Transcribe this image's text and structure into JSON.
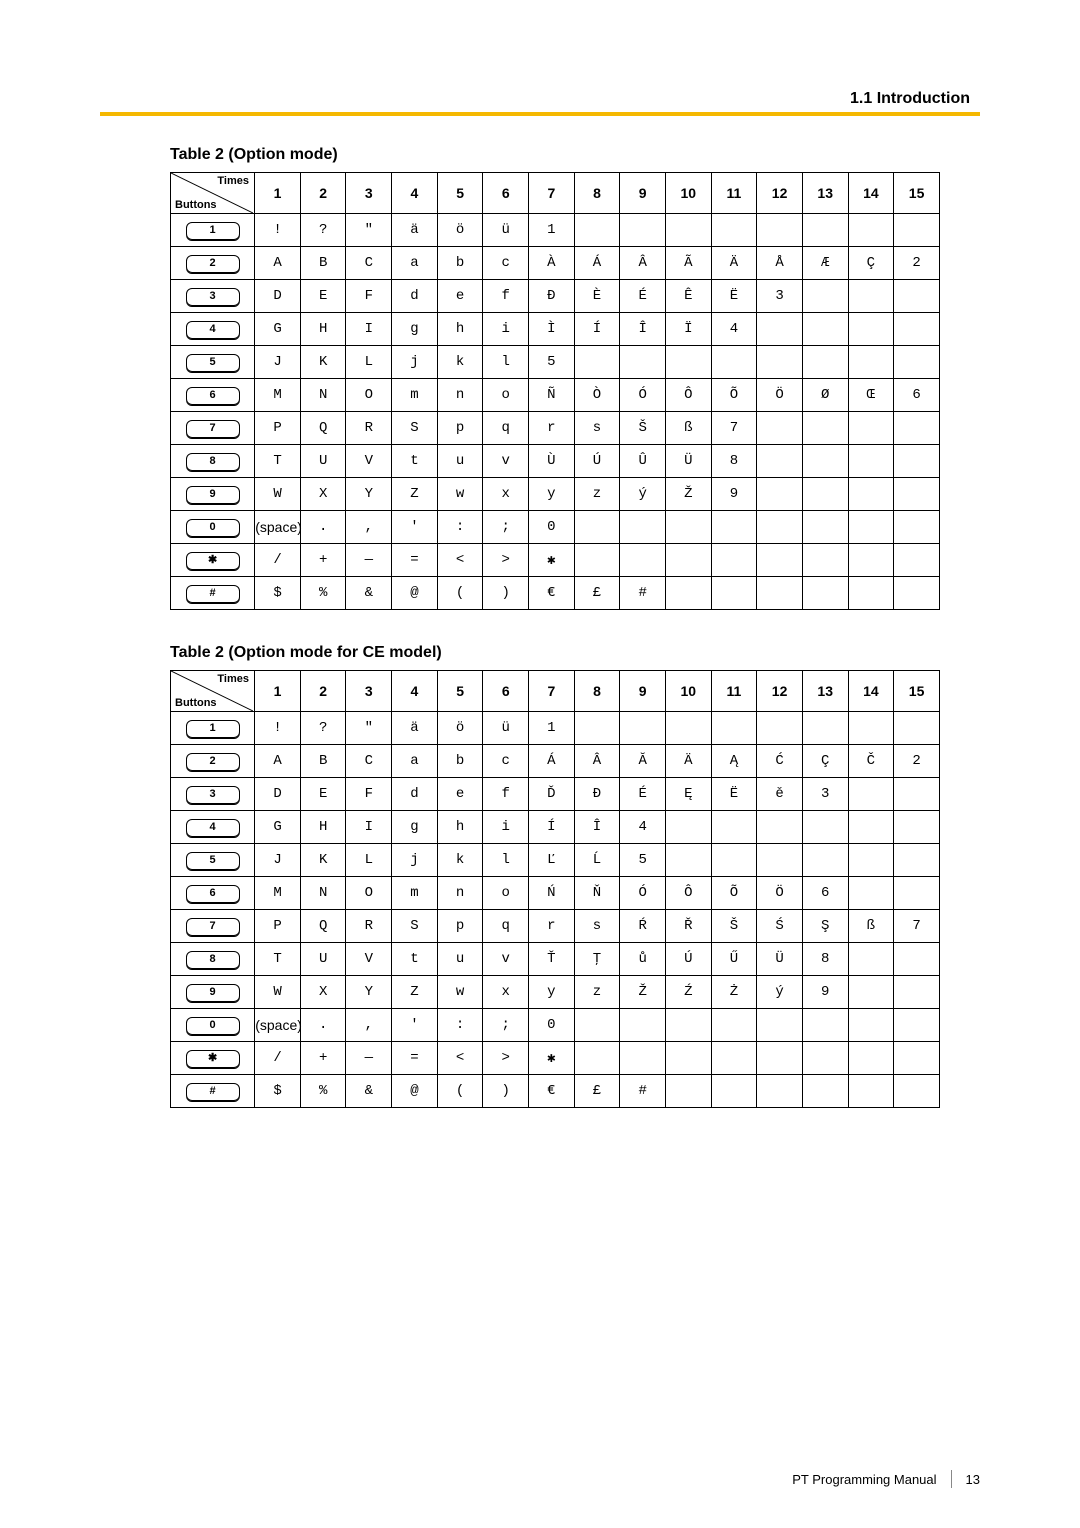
{
  "header": {
    "section": "1.1 Introduction"
  },
  "footer": {
    "manual": "PT Programming Manual",
    "page": "13"
  },
  "table1": {
    "title": "Table 2 (Option mode)",
    "corner_top": "Times",
    "corner_bottom": "Buttons",
    "headers": [
      "1",
      "2",
      "3",
      "4",
      "5",
      "6",
      "7",
      "8",
      "9",
      "10",
      "11",
      "12",
      "13",
      "14",
      "15"
    ],
    "rows": [
      {
        "button": "1",
        "cells": [
          "!",
          "?",
          "\"",
          "ä",
          "ö",
          "ü",
          "1",
          "",
          "",
          "",
          "",
          "",
          "",
          "",
          ""
        ]
      },
      {
        "button": "2",
        "cells": [
          "A",
          "B",
          "C",
          "a",
          "b",
          "c",
          "À",
          "Á",
          "Â",
          "Ã",
          "Ä",
          "Å",
          "Æ",
          "Ç",
          "2"
        ]
      },
      {
        "button": "3",
        "cells": [
          "D",
          "E",
          "F",
          "d",
          "e",
          "f",
          "Ð",
          "È",
          "É",
          "Ê",
          "Ë",
          "3",
          "",
          "",
          ""
        ]
      },
      {
        "button": "4",
        "cells": [
          "G",
          "H",
          "I",
          "g",
          "h",
          "i",
          "Ì",
          "Í",
          "Î",
          "Ï",
          "4",
          "",
          "",
          "",
          ""
        ]
      },
      {
        "button": "5",
        "cells": [
          "J",
          "K",
          "L",
          "j",
          "k",
          "l",
          "5",
          "",
          "",
          "",
          "",
          "",
          "",
          "",
          ""
        ]
      },
      {
        "button": "6",
        "cells": [
          "M",
          "N",
          "O",
          "m",
          "n",
          "o",
          "Ñ",
          "Ò",
          "Ó",
          "Ô",
          "Õ",
          "Ö",
          "Ø",
          "Œ",
          "6"
        ]
      },
      {
        "button": "7",
        "cells": [
          "P",
          "Q",
          "R",
          "S",
          "p",
          "q",
          "r",
          "s",
          "Š",
          "ß",
          "7",
          "",
          "",
          "",
          ""
        ]
      },
      {
        "button": "8",
        "cells": [
          "T",
          "U",
          "V",
          "t",
          "u",
          "v",
          "Ù",
          "Ú",
          "Û",
          "Ü",
          "8",
          "",
          "",
          "",
          ""
        ]
      },
      {
        "button": "9",
        "cells": [
          "W",
          "X",
          "Y",
          "Z",
          "w",
          "x",
          "y",
          "z",
          "ý",
          "Ž",
          "9",
          "",
          "",
          "",
          ""
        ]
      },
      {
        "button": "0",
        "cells": [
          "(space)",
          ".",
          ",",
          "'",
          ":",
          ";",
          "0",
          "",
          "",
          "",
          "",
          "",
          "",
          "",
          ""
        ]
      },
      {
        "button": "✱",
        "cells": [
          "/",
          "+",
          "—",
          "=",
          "<",
          ">",
          "✱",
          "",
          "",
          "",
          "",
          "",
          "",
          "",
          ""
        ]
      },
      {
        "button": "#",
        "cells": [
          "$",
          "%",
          "&",
          "@",
          "(",
          ")",
          "€",
          "£",
          "#",
          "",
          "",
          "",
          "",
          "",
          ""
        ]
      }
    ]
  },
  "table2": {
    "title": "Table 2 (Option mode for CE model)",
    "corner_top": "Times",
    "corner_bottom": "Buttons",
    "headers": [
      "1",
      "2",
      "3",
      "4",
      "5",
      "6",
      "7",
      "8",
      "9",
      "10",
      "11",
      "12",
      "13",
      "14",
      "15"
    ],
    "rows": [
      {
        "button": "1",
        "cells": [
          "!",
          "?",
          "\"",
          "ä",
          "ö",
          "ü",
          "1",
          "",
          "",
          "",
          "",
          "",
          "",
          "",
          ""
        ]
      },
      {
        "button": "2",
        "cells": [
          "A",
          "B",
          "C",
          "a",
          "b",
          "c",
          "Á",
          "Â",
          "Ă",
          "Ä",
          "Ą",
          "Ć",
          "Ç",
          "Č",
          "2"
        ]
      },
      {
        "button": "3",
        "cells": [
          "D",
          "E",
          "F",
          "d",
          "e",
          "f",
          "Ď",
          "Đ",
          "É",
          "Ę",
          "Ë",
          "ě",
          "3",
          "",
          ""
        ]
      },
      {
        "button": "4",
        "cells": [
          "G",
          "H",
          "I",
          "g",
          "h",
          "i",
          "Í",
          "Î",
          "4",
          "",
          "",
          "",
          "",
          "",
          ""
        ]
      },
      {
        "button": "5",
        "cells": [
          "J",
          "K",
          "L",
          "j",
          "k",
          "l",
          "Ľ",
          "Ĺ",
          "5",
          "",
          "",
          "",
          "",
          "",
          ""
        ]
      },
      {
        "button": "6",
        "cells": [
          "M",
          "N",
          "O",
          "m",
          "n",
          "o",
          "Ń",
          "Ň",
          "Ó",
          "Ô",
          "Õ",
          "Ö",
          "6",
          "",
          ""
        ]
      },
      {
        "button": "7",
        "cells": [
          "P",
          "Q",
          "R",
          "S",
          "p",
          "q",
          "r",
          "s",
          "Ŕ",
          "Ř",
          "Š",
          "Ś",
          "Ş",
          "ß",
          "7"
        ]
      },
      {
        "button": "8",
        "cells": [
          "T",
          "U",
          "V",
          "t",
          "u",
          "v",
          "Ť",
          "Ţ",
          "ů",
          "Ú",
          "Ű",
          "Ü",
          "8",
          "",
          ""
        ]
      },
      {
        "button": "9",
        "cells": [
          "W",
          "X",
          "Y",
          "Z",
          "w",
          "x",
          "y",
          "z",
          "Ž",
          "Ź",
          "Ż",
          "ý",
          "9",
          "",
          ""
        ]
      },
      {
        "button": "0",
        "cells": [
          "(space)",
          ".",
          ",",
          "'",
          ":",
          ";",
          "0",
          "",
          "",
          "",
          "",
          "",
          "",
          "",
          ""
        ]
      },
      {
        "button": "✱",
        "cells": [
          "/",
          "+",
          "—",
          "=",
          "<",
          ">",
          "✱",
          "",
          "",
          "",
          "",
          "",
          "",
          "",
          ""
        ]
      },
      {
        "button": "#",
        "cells": [
          "$",
          "%",
          "&",
          "@",
          "(",
          ")",
          "€",
          "£",
          "#",
          "",
          "",
          "",
          "",
          "",
          ""
        ]
      }
    ]
  }
}
